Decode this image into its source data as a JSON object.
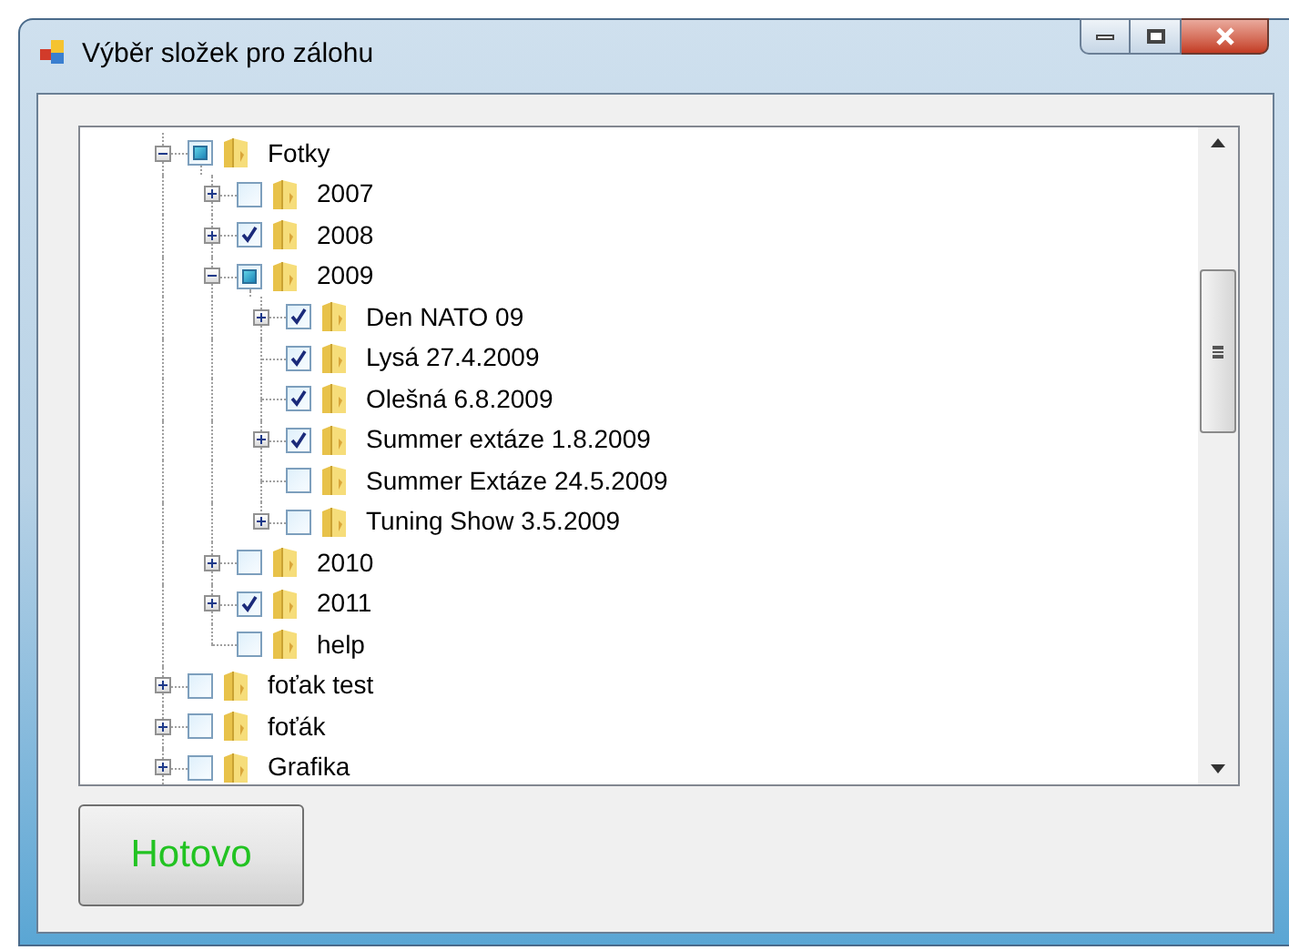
{
  "window": {
    "title": "Výběr složek pro zálohu"
  },
  "tree": [
    {
      "label": "Fotky",
      "kind": "branch",
      "expanded": true,
      "checked": false,
      "partial": true,
      "children": [
        {
          "label": "2007",
          "kind": "branch",
          "expanded": false,
          "checked": false,
          "partial": false
        },
        {
          "label": "2008",
          "kind": "branch",
          "expanded": false,
          "checked": true,
          "partial": false
        },
        {
          "label": "2009",
          "kind": "branch",
          "expanded": true,
          "checked": false,
          "partial": true,
          "children": [
            {
              "label": "Den NATO 09",
              "kind": "branch",
              "expanded": false,
              "checked": true,
              "partial": false
            },
            {
              "label": "Lysá 27.4.2009",
              "kind": "leaf",
              "expanded": false,
              "checked": true,
              "partial": false
            },
            {
              "label": "Olešná 6.8.2009",
              "kind": "leaf",
              "expanded": false,
              "checked": true,
              "partial": false
            },
            {
              "label": "Summer extáze 1.8.2009",
              "kind": "branch",
              "expanded": false,
              "checked": true,
              "partial": false
            },
            {
              "label": "Summer Extáze 24.5.2009",
              "kind": "leaf",
              "expanded": false,
              "checked": false,
              "partial": false
            },
            {
              "label": "Tuning Show 3.5.2009",
              "kind": "branch",
              "expanded": false,
              "checked": false,
              "partial": false
            }
          ]
        },
        {
          "label": "2010",
          "kind": "branch",
          "expanded": false,
          "checked": false,
          "partial": false
        },
        {
          "label": "2011",
          "kind": "branch",
          "expanded": false,
          "checked": true,
          "partial": false
        },
        {
          "label": "help",
          "kind": "leaf",
          "expanded": false,
          "checked": false,
          "partial": false
        }
      ]
    },
    {
      "label": "foťak test",
      "kind": "branch",
      "expanded": false,
      "checked": false,
      "partial": false
    },
    {
      "label": "foťák",
      "kind": "branch",
      "expanded": false,
      "checked": false,
      "partial": false
    },
    {
      "label": "Grafika",
      "kind": "branch",
      "expanded": false,
      "checked": false,
      "partial": false
    }
  ],
  "buttons": [
    {
      "label": "Hotovo"
    }
  ]
}
